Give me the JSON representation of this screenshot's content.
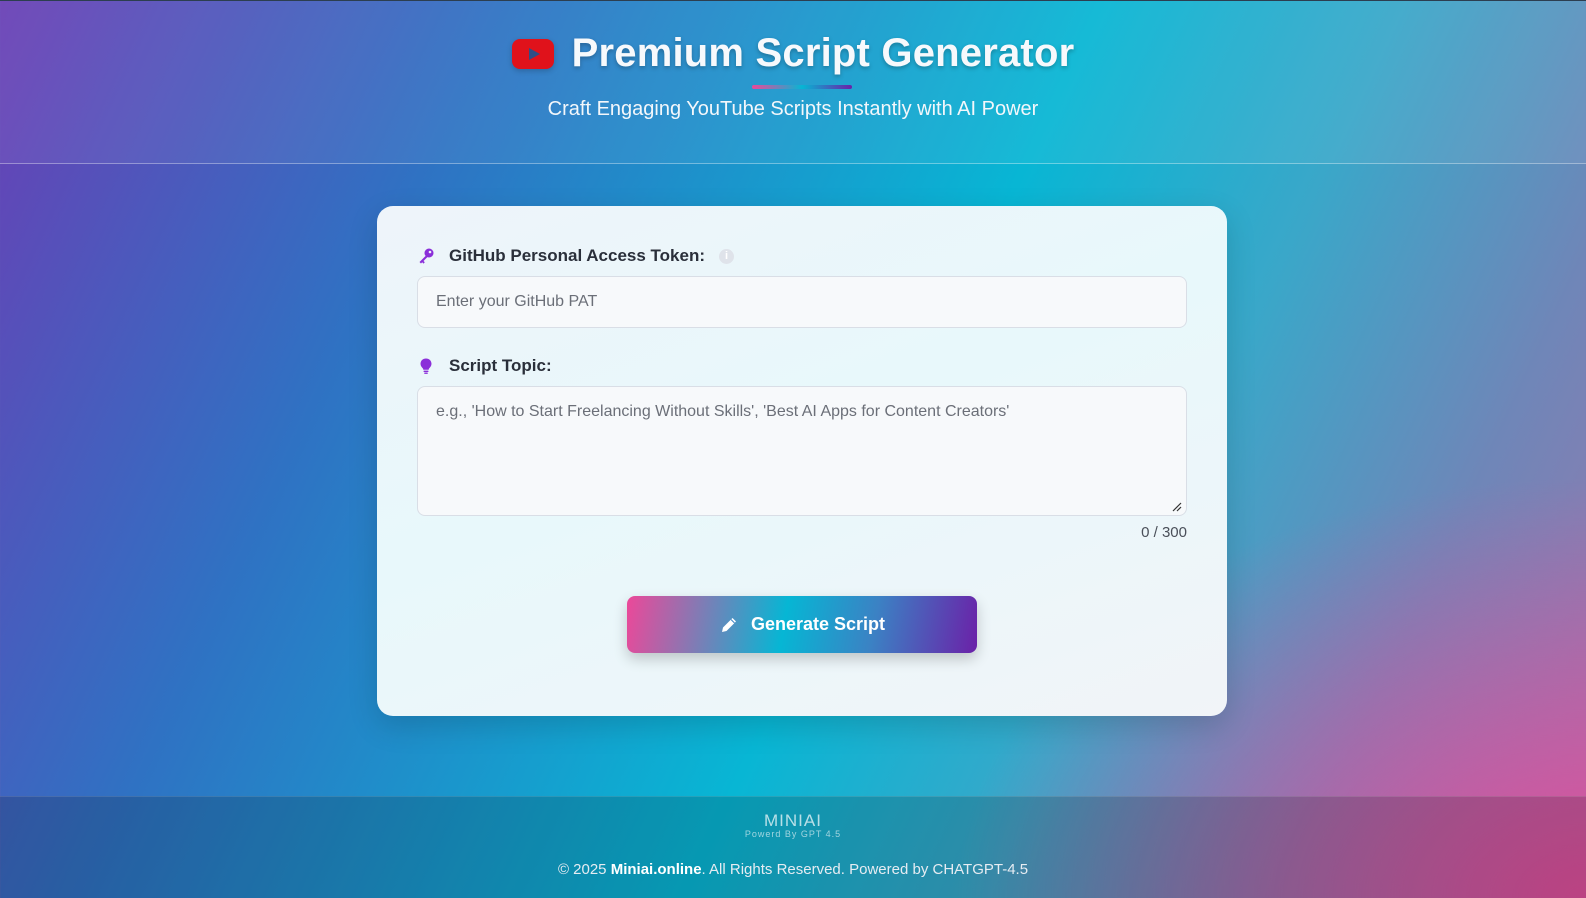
{
  "header": {
    "title": "Premium Script Generator",
    "subtitle": "Craft Engaging YouTube Scripts Instantly with AI Power",
    "icon": "youtube-icon"
  },
  "form": {
    "token": {
      "label": "GitHub Personal Access Token:",
      "icon": "key-icon",
      "info_icon": "info-icon",
      "placeholder": "Enter your GitHub PAT",
      "value": ""
    },
    "topic": {
      "label": "Script Topic:",
      "icon": "lightbulb-icon",
      "placeholder": "e.g., 'How to Start Freelancing Without Skills', 'Best AI Apps for Content Creators'",
      "value": "",
      "char_count": "0 / 300"
    },
    "generate_button": {
      "label": "Generate Script",
      "icon": "pencil-icon"
    }
  },
  "footer": {
    "logo_text": "MINIAI",
    "logo_tagline": "Powerd By GPT 4.5",
    "copyright_prefix": "© 2025 ",
    "site_name": "Miniai.online",
    "copyright_suffix": ". All Rights Reserved. Powered by CHATGPT-4.5"
  },
  "colors": {
    "accent_pink": "#ec4899",
    "accent_cyan": "#06b6d4",
    "accent_purple": "#6b21a8",
    "icon_purple": "#8b2fd9",
    "youtube_red": "#e0121b"
  }
}
